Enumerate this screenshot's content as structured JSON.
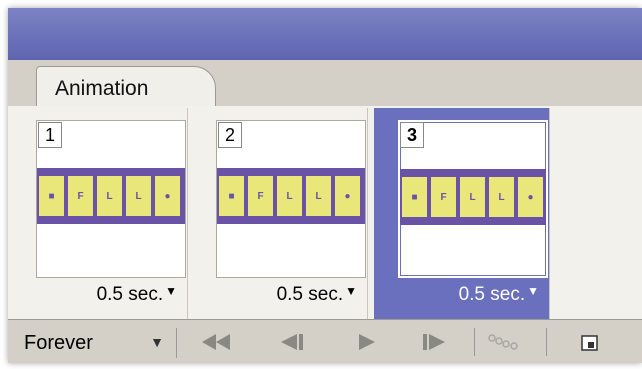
{
  "panel": {
    "tab_label": "Animation"
  },
  "frames": [
    {
      "number": "1",
      "delay": "0.5 sec.",
      "selected": false
    },
    {
      "number": "2",
      "delay": "0.5 sec.",
      "selected": false
    },
    {
      "number": "3",
      "delay": "0.5 sec.",
      "selected": true
    }
  ],
  "thumbnail_cells": [
    "■",
    "F",
    "L",
    "L",
    "●"
  ],
  "toolbar": {
    "loop_value": "Forever",
    "buttons": [
      {
        "name": "first-frame-button",
        "icon": "first-frame-icon"
      },
      {
        "name": "previous-frame-button",
        "icon": "previous-frame-icon"
      },
      {
        "name": "play-button",
        "icon": "play-icon"
      },
      {
        "name": "next-frame-button",
        "icon": "next-frame-icon"
      },
      {
        "name": "tween-button",
        "icon": "tween-icon"
      },
      {
        "name": "duplicate-frame-button",
        "icon": "new-frame-icon"
      }
    ]
  },
  "colors": {
    "titlebar": "#6a6fbe",
    "selected_frame": "#6a6fbe",
    "strip": "#6a52a6",
    "cell": "#e9e77a"
  }
}
